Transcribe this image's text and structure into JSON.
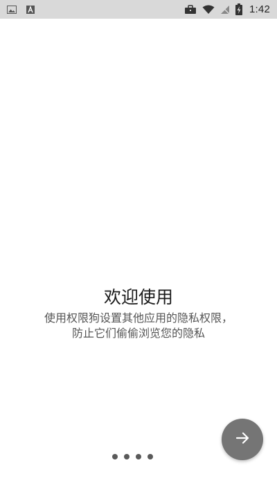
{
  "status_bar": {
    "time": "1:42",
    "left_icons": [
      "image-icon",
      "font-icon"
    ],
    "right_icons": [
      "briefcase-icon",
      "wifi-icon",
      "no-sim-icon",
      "battery-charging-icon"
    ]
  },
  "welcome": {
    "title": "欢迎使用",
    "description_line1": "使用权限狗设置其他应用的隐私权限，",
    "description_line2": "防止它们偷偷浏览您的隐私"
  },
  "pager": {
    "page_count": 4
  },
  "next_button": {
    "icon": "arrow-right-icon",
    "color": "#757575"
  }
}
